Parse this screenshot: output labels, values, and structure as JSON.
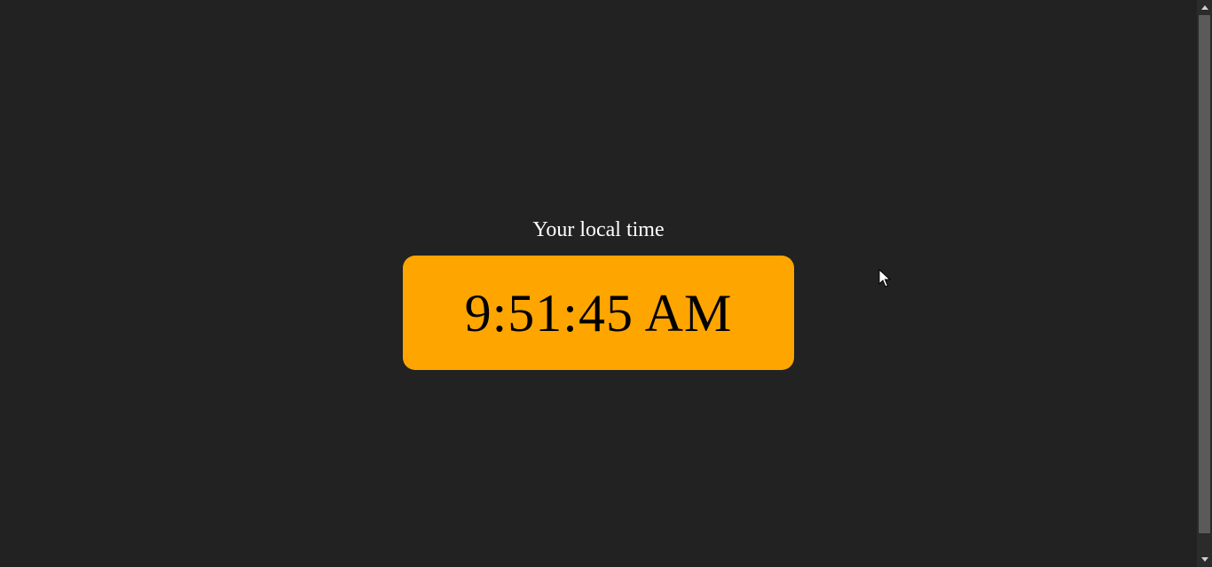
{
  "clock": {
    "label": "Your local time",
    "time": "9:51:45 AM"
  },
  "colors": {
    "background": "#222222",
    "box": "#ffa500",
    "label_text": "#ffffff",
    "time_text": "#000000"
  },
  "icons": {
    "scroll_up": "chevron-up-icon",
    "scroll_down": "chevron-down-icon",
    "cursor": "mouse-pointer-icon"
  }
}
